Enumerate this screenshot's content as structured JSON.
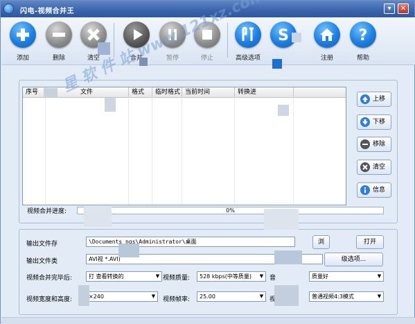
{
  "window": {
    "title": "闪电-视频合并王",
    "minimize_glyph": "▾",
    "close_glyph": "✕"
  },
  "toolbar": [
    {
      "label": "添加",
      "icon": "plus-icon"
    },
    {
      "label": "删除",
      "icon": "minus-icon"
    },
    {
      "label": "清空",
      "icon": "clear-icon"
    },
    {
      "label": "合并",
      "icon": "play-icon"
    },
    {
      "label": "暂停",
      "icon": "pause-icon"
    },
    {
      "label": "停止",
      "icon": "stop-icon"
    },
    {
      "label": "高级选项",
      "icon": "settings-icon"
    },
    {
      "label": "",
      "icon": "s-icon"
    },
    {
      "label": "注册",
      "icon": "home-icon"
    },
    {
      "label": "帮助",
      "icon": "help-icon"
    }
  ],
  "grid": {
    "columns": [
      "序号",
      "文件",
      "格式",
      "临时格式",
      "当前时间",
      "转换进",
      ""
    ]
  },
  "side_buttons": [
    {
      "label": "上移",
      "icon": "arrow-up-icon"
    },
    {
      "label": "下移",
      "icon": "arrow-down-icon"
    },
    {
      "label": "移除",
      "icon": "remove-icon"
    },
    {
      "label": "清空",
      "icon": "clear-list-icon"
    },
    {
      "label": "信息",
      "icon": "info-icon"
    }
  ],
  "progress": {
    "label": "视频合并进度:",
    "value": 0,
    "text": "0%"
  },
  "settings": {
    "output_folder_label": "输出文件存",
    "output_folder_value": "\\Documents       ngs\\Administrator\\桌面",
    "open_button": "打开",
    "browse_button": "浏",
    "output_type_label": "输出文件类",
    "output_type_value": "AVI视       *.AVI)",
    "advanced_button": "级选项...",
    "after_merge_label": "视频合并完毕后:",
    "after_merge_value": "打     查看转换的",
    "video_quality_label": "视频质量:",
    "video_quality_value": "528 kbps(中等质量)",
    "audio_label": "音",
    "audio_value": "质量好",
    "size_label": "视频宽度和高度:",
    "size_value": "  ×240",
    "fps_label": "视频帧率:",
    "fps_value": "25.00",
    "aspect_label": "视",
    "aspect_value": "普通视频4:3模式"
  },
  "watermark": "星 软 件 站   www.121xz.com",
  "colors": {
    "titlebar": "#3c66ae",
    "accent_blue": "#1d7ee0",
    "progress": "#5b9bd5"
  }
}
